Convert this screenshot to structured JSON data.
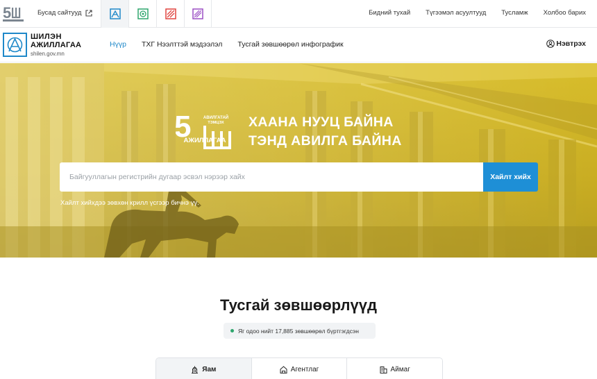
{
  "topbar": {
    "logo_icon": "5sh-campaign-logo",
    "other_sites_label": "Бусад сайтууд",
    "site_tabs": [
      {
        "icon": "shilen-site-icon",
        "color": "#1e88c9",
        "active": true
      },
      {
        "icon": "registry-site-icon",
        "color": "#2ea66d",
        "active": false
      },
      {
        "icon": "stats-site-icon",
        "color": "#e0443f",
        "active": false
      },
      {
        "icon": "report-site-icon",
        "color": "#9b4fc4",
        "active": false
      }
    ],
    "menu": [
      "Бидний тухай",
      "Түгээмэл асуултууд",
      "Тусламж",
      "Холбоо барих"
    ]
  },
  "header": {
    "brand_line1": "ШИЛЭН",
    "brand_line2": "АЖИЛЛАГАА",
    "brand_domain": "shilen.gov.mn",
    "nav": [
      {
        "label": "Нүүр",
        "active": true
      },
      {
        "label": "ТХГ Нээлттэй мэдээлэл",
        "active": false
      },
      {
        "label": "Тусгай зөвшөөрөл инфографик",
        "active": false
      }
    ],
    "login_label": "Нэвтрэх",
    "accent_color": "#1e88c9"
  },
  "hero": {
    "logo_small_line1": "АВИЛГАТАЙ",
    "logo_small_line2": "ТЭМЦЭХ",
    "logo_word": "АЖИЛЛАГАА",
    "slogan_line1": "ХААНА НУУЦ БАЙНА",
    "slogan_line2": "ТЭНД АВИЛГА БАЙНА",
    "search_placeholder": "Байгууллагын регистрийн дугаар эсвэл нэрээр хайх",
    "search_button": "Хайлт хийх",
    "search_hint": "Хайлт хийхдээ зөвхөн крилл үсгээр бичнэ үү.",
    "tint_color": "#d8bd2a"
  },
  "licenses": {
    "title": "Тусгай зөвшөөрлүүд",
    "stat_text": "Яг одоо нийт 17,885 зөвшөөрөл бүртгэгдсэн",
    "tabs": [
      {
        "label": "Яам",
        "icon": "ministry-icon"
      },
      {
        "label": "Агентлаг",
        "icon": "agency-icon"
      },
      {
        "label": "Аймаг",
        "icon": "province-icon"
      }
    ]
  }
}
